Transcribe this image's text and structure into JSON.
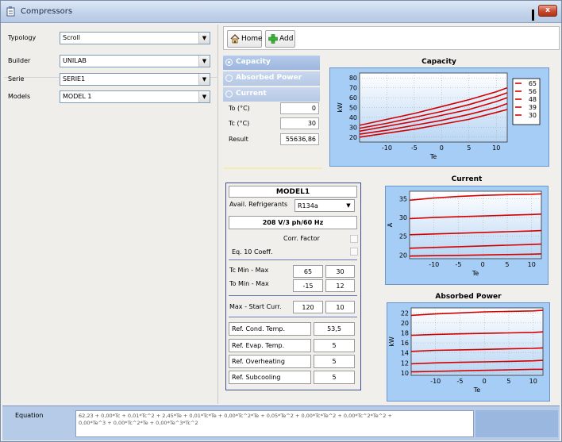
{
  "window": {
    "title": "Compressors",
    "close_glyph": "x"
  },
  "left": {
    "typology": {
      "label": "Typology",
      "value": "Scroll"
    },
    "builder": {
      "label": "Builder",
      "value": "UNILAB"
    },
    "serie": {
      "label": "Serie",
      "value": "SERIE1"
    },
    "models": {
      "label": "Models",
      "value": "MODEL 1"
    }
  },
  "toolbar": {
    "home_label": "Home",
    "add_label": "Add"
  },
  "radio": {
    "capacity": "Capacity",
    "absorbed": "Absorbed Power",
    "current": "Current",
    "selected": "capacity"
  },
  "calc": {
    "to_label": "To (°C)",
    "to_value": "0",
    "tc_label": "Tc (°C)",
    "tc_value": "30",
    "result_label": "Result",
    "result_value": "55636,86"
  },
  "model": {
    "name": "MODEL1",
    "refrig_label": "Avail. Refrigerants",
    "refrig_value": "R134a",
    "power": "208 V/3 ph/60 Hz",
    "corr_factor": "Corr. Factor",
    "eq10": "Eq. 10 Coeff.",
    "tc_minmax_label": "Tc Min - Max",
    "tc_min": "65",
    "tc_max": "30",
    "to_minmax_label": "To Min - Max",
    "to_min": "-15",
    "to_max": "12",
    "curr_label": "Max - Start Curr.",
    "curr_max": "120",
    "curr_start": "10",
    "cond_label": "Ref. Cond. Temp.",
    "cond_value": "53,5",
    "evap_label": "Ref. Evap. Temp.",
    "evap_value": "5",
    "overheat_label": "Ref. Overheating",
    "overheat_value": "5",
    "subcool_label": "Ref. Subcooling",
    "subcool_value": "5"
  },
  "equation": {
    "label": "Equation",
    "line1": "62,23 + 0,00*Tc + 0,01*Tc^2 + 2,45*Te + 0,01*Tc*Te + 0,00*Tc^2*Te + 0,05*Te^2 + 0,00*Tc*Te^2 + 0,00*Tc^2*Te^2 +",
    "line2": "0,00*Te^3 + 0,00*Tc^2*Te + 0,00*Te^3*Tc^2"
  },
  "colors": {
    "curve": "#d40000",
    "chart_bg": "#a6cdf5",
    "selected_radio": "#9db6de"
  },
  "chart_data": [
    {
      "type": "line",
      "title": "Capacity",
      "xlabel": "Te",
      "ylabel": "kW",
      "xlim": [
        -15,
        12
      ],
      "ylim": [
        15,
        85
      ],
      "xticks": [
        -10,
        -5,
        0,
        5,
        10
      ],
      "yticks": [
        20,
        30,
        40,
        50,
        60,
        70,
        80
      ],
      "legend_position": "right",
      "series": [
        {
          "name": "65",
          "x": [
            -15,
            -10,
            -5,
            0,
            5,
            10,
            12
          ],
          "y": [
            32,
            38,
            44,
            51,
            58,
            66,
            70
          ]
        },
        {
          "name": "56",
          "x": [
            -15,
            -10,
            -5,
            0,
            5,
            10,
            12
          ],
          "y": [
            29,
            34,
            40,
            46,
            53,
            61,
            65
          ]
        },
        {
          "name": "48",
          "x": [
            -15,
            -10,
            -5,
            0,
            5,
            10,
            12
          ],
          "y": [
            26,
            31,
            36,
            42,
            48,
            56,
            60
          ]
        },
        {
          "name": "39",
          "x": [
            -15,
            -10,
            -5,
            0,
            5,
            10,
            12
          ],
          "y": [
            23,
            27,
            32,
            37,
            43,
            50,
            54
          ]
        },
        {
          "name": "30",
          "x": [
            -15,
            -10,
            -5,
            0,
            5,
            10,
            12
          ],
          "y": [
            20,
            24,
            28,
            33,
            38,
            45,
            48
          ]
        }
      ]
    },
    {
      "type": "line",
      "title": "Current",
      "xlabel": "Te",
      "ylabel": "A",
      "xlim": [
        -15,
        12
      ],
      "ylim": [
        19,
        37
      ],
      "xticks": [
        -10,
        -5,
        0,
        5,
        10
      ],
      "yticks": [
        20,
        25,
        30,
        35
      ],
      "series": [
        {
          "x": [
            -15,
            -10,
            -5,
            0,
            5,
            10,
            12
          ],
          "y": [
            34.6,
            35.2,
            35.6,
            35.9,
            36.1,
            36.2,
            36.3
          ]
        },
        {
          "x": [
            -15,
            -10,
            -5,
            0,
            5,
            10,
            12
          ],
          "y": [
            29.7,
            30.0,
            30.2,
            30.4,
            30.6,
            30.8,
            30.9
          ]
        },
        {
          "x": [
            -15,
            -10,
            -5,
            0,
            5,
            10,
            12
          ],
          "y": [
            25.4,
            25.6,
            25.8,
            26.0,
            26.2,
            26.4,
            26.5
          ]
        },
        {
          "x": [
            -15,
            -10,
            -5,
            0,
            5,
            10,
            12
          ],
          "y": [
            21.8,
            22.0,
            22.2,
            22.4,
            22.6,
            22.8,
            22.9
          ]
        },
        {
          "x": [
            -15,
            -10,
            -5,
            0,
            5,
            10,
            12
          ],
          "y": [
            19.7,
            19.8,
            19.9,
            20.0,
            20.1,
            20.2,
            20.3
          ]
        }
      ]
    },
    {
      "type": "line",
      "title": "Absorbed Power",
      "xlabel": "Te",
      "ylabel": "kW",
      "xlim": [
        -15,
        12
      ],
      "ylim": [
        9.5,
        23
      ],
      "xticks": [
        -10,
        -5,
        0,
        5,
        10
      ],
      "yticks": [
        10,
        12,
        14,
        16,
        18,
        20,
        22
      ],
      "series": [
        {
          "x": [
            -15,
            -10,
            -5,
            0,
            5,
            10,
            12
          ],
          "y": [
            21.5,
            21.8,
            22.0,
            22.2,
            22.3,
            22.4,
            22.5
          ]
        },
        {
          "x": [
            -15,
            -10,
            -5,
            0,
            5,
            10,
            12
          ],
          "y": [
            17.5,
            17.7,
            17.8,
            17.9,
            18.0,
            18.1,
            18.2
          ]
        },
        {
          "x": [
            -15,
            -10,
            -5,
            0,
            5,
            10,
            12
          ],
          "y": [
            14.3,
            14.5,
            14.6,
            14.7,
            14.8,
            14.9,
            15.0
          ]
        },
        {
          "x": [
            -15,
            -10,
            -5,
            0,
            5,
            10,
            12
          ],
          "y": [
            11.8,
            12.0,
            12.1,
            12.2,
            12.3,
            12.4,
            12.5
          ]
        },
        {
          "x": [
            -15,
            -10,
            -5,
            0,
            5,
            10,
            12
          ],
          "y": [
            10.2,
            10.3,
            10.4,
            10.5,
            10.6,
            10.7,
            10.7
          ]
        }
      ]
    }
  ]
}
